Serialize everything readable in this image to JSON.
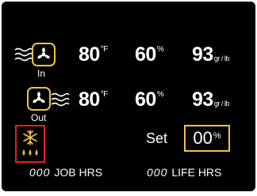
{
  "rows": {
    "in": {
      "label": "In",
      "temp": "80",
      "temp_unit": "°F",
      "humidity": "60",
      "humidity_unit": "%",
      "grains": "93",
      "grains_unit": "gr / lb"
    },
    "out": {
      "label": "Out",
      "temp": "80",
      "temp_unit": "°F",
      "humidity": "60",
      "humidity_unit": "%",
      "grains": "93",
      "grains_unit": "gr / lb"
    }
  },
  "setpoint": {
    "label": "Set",
    "value": "00",
    "unit": "%"
  },
  "footer": {
    "job_digits": "000",
    "job_label": "JOB HRS",
    "life_digits": "000",
    "life_label": "LIFE HRS"
  },
  "icons": {
    "inlet_fan": "fan-icon",
    "inlet_wind": "wind-icon",
    "outlet_fan": "fan-icon",
    "outlet_wind": "wind-icon",
    "mode": "snowflake-drops-icon"
  },
  "colors": {
    "background": "#000000",
    "accent": "#f0c24a",
    "alert": "#e02020",
    "text": "#ffffff"
  }
}
